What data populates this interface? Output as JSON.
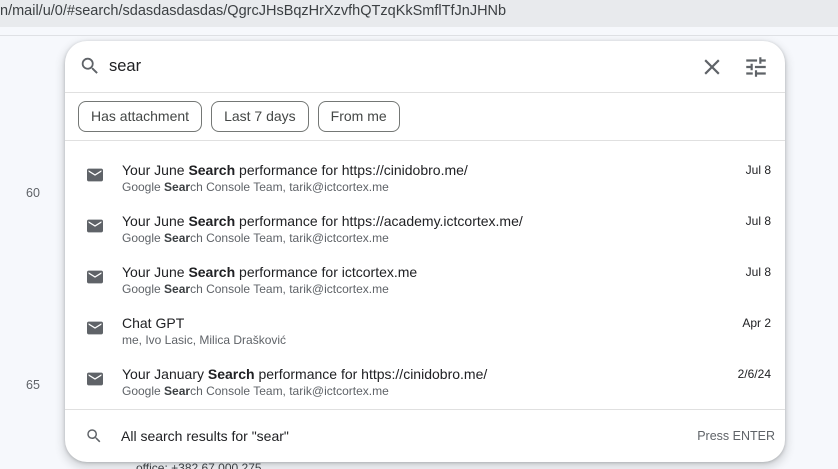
{
  "browser": {
    "url": "n/mail/u/0/#search/sdasdasdasdas/QgrcJHsBqzHrXzvfhQTzqKkSmflTfJnJHNb"
  },
  "background": {
    "gutter_numbers": [
      "60",
      "65"
    ],
    "partial_text": "office: +382 67 000 275"
  },
  "search": {
    "query": "sear",
    "clear_icon": "close-icon",
    "options_icon": "tune-icon"
  },
  "chips": [
    "Has attachment",
    "Last 7 days",
    "From me"
  ],
  "results": [
    {
      "subject_pre": "Your June ",
      "subject_bold": "Search",
      "subject_post": " performance for https://cinidobro.me/",
      "from_pre": "Google ",
      "from_bold": "Sear",
      "from_post": "ch Console Team, tarik@ictcortex.me",
      "date": "Jul 8"
    },
    {
      "subject_pre": "Your June ",
      "subject_bold": "Search",
      "subject_post": " performance for https://academy.ictcortex.me/",
      "from_pre": "Google ",
      "from_bold": "Sear",
      "from_post": "ch Console Team, tarik@ictcortex.me",
      "date": "Jul 8"
    },
    {
      "subject_pre": "Your June ",
      "subject_bold": "Search",
      "subject_post": " performance for ictcortex.me",
      "from_pre": "Google ",
      "from_bold": "Sear",
      "from_post": "ch Console Team, tarik@ictcortex.me",
      "date": "Jul 8"
    },
    {
      "subject_pre": "Chat GPT",
      "subject_bold": "",
      "subject_post": "",
      "from_pre": "me, Ivo Lasic, Milica Drašković",
      "from_bold": "",
      "from_post": "",
      "date": "Apr 2"
    },
    {
      "subject_pre": "Your January ",
      "subject_bold": "Search",
      "subject_post": " performance for https://cinidobro.me/",
      "from_pre": "Google ",
      "from_bold": "Sear",
      "from_post": "ch Console Team, tarik@ictcortex.me",
      "date": "2/6/24"
    }
  ],
  "footer": {
    "label": "All search results for \"sear\"",
    "hint": "Press ENTER"
  },
  "colors": {
    "panel_bg": "#ffffff",
    "page_bg": "#f6f8fc",
    "icon": "#5f6368",
    "chip_border": "#747775"
  }
}
